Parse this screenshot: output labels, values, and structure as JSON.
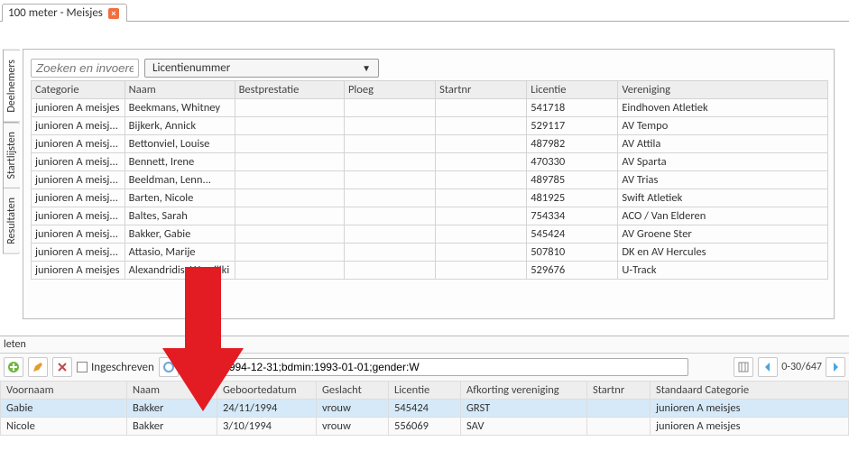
{
  "tab": {
    "title": "100 meter - Meisjes"
  },
  "sidebar": {
    "deelnemers": "Deelnemers",
    "startlijsten": "Startlijsten",
    "resultaten": "Resultaten"
  },
  "toolbar": {
    "search_placeholder": "Zoeken en invoeren …",
    "dropdown_value": "Licentienummer"
  },
  "columns": {
    "categorie": "Categorie",
    "naam": "Naam",
    "bestprestatie": "Bestprestatie",
    "ploeg": "Ploeg",
    "startnr": "Startnr",
    "licentie": "Licentie",
    "vereniging": "Vereniging"
  },
  "rows": [
    {
      "cat": "junioren A meisjes",
      "naam": "Beekmans, Whitney",
      "lic": "541718",
      "ver": "Eindhoven Atletiek"
    },
    {
      "cat": "junioren A meisj...",
      "naam": "Bijkerk, Annick",
      "lic": "529117",
      "ver": "AV Tempo"
    },
    {
      "cat": "junioren A meisj...",
      "naam": "Bettonviel, Louise",
      "lic": "487982",
      "ver": "AV Attila"
    },
    {
      "cat": "junioren A meisj...",
      "naam": "Bennett, Irene",
      "lic": "470330",
      "ver": "AV Sparta"
    },
    {
      "cat": "junioren A meisj...",
      "naam": "Beeldman, Lenn...",
      "lic": "489785",
      "ver": "AV Trias"
    },
    {
      "cat": "junioren A meisj...",
      "naam": "Barten, Nicole",
      "lic": "481925",
      "ver": "Swift Atletiek"
    },
    {
      "cat": "junioren A meisj...",
      "naam": "Baltes, Sarah",
      "lic": "754334",
      "ver": "ACO / Van Elderen"
    },
    {
      "cat": "junioren A meisj...",
      "naam": "Bakker, Gabie",
      "lic": "545424",
      "ver": "AV Groene Ster"
    },
    {
      "cat": "junioren A meisj...",
      "naam": "Attasio, Marije",
      "lic": "507810",
      "ver": "DK en AV Hercules"
    },
    {
      "cat": "junioren A meisjes",
      "naam": "Alexandridis, Wassiliki",
      "lic": "529676",
      "ver": "U-Track"
    }
  ],
  "lower": {
    "title": "leten",
    "ingeschreven": "Ingeschreven",
    "filter": "bdmax:1994-12-31;bdmin:1993-01-01;gender:W",
    "pager": "0-30/647",
    "columns": {
      "voornaam": "Voornaam",
      "naam": "Naam",
      "geb": "Geboortedatum",
      "geslacht": "Geslacht",
      "licentie": "Licentie",
      "afk": "Afkorting vereniging",
      "startnr": "Startnr",
      "std": "Standaard Categorie"
    },
    "rows": [
      {
        "voornaam": "Gabie",
        "naam": "Bakker",
        "geb": "24/11/1994",
        "ges": "vrouw",
        "lic": "545424",
        "afk": "GRST",
        "start": "",
        "std": "junioren A meisjes",
        "sel": true
      },
      {
        "voornaam": "Nicole",
        "naam": "Bakker",
        "geb": "3/10/1994",
        "ges": "vrouw",
        "lic": "556069",
        "afk": "SAV",
        "start": "",
        "std": "junioren A meisjes",
        "sel": false
      }
    ]
  }
}
